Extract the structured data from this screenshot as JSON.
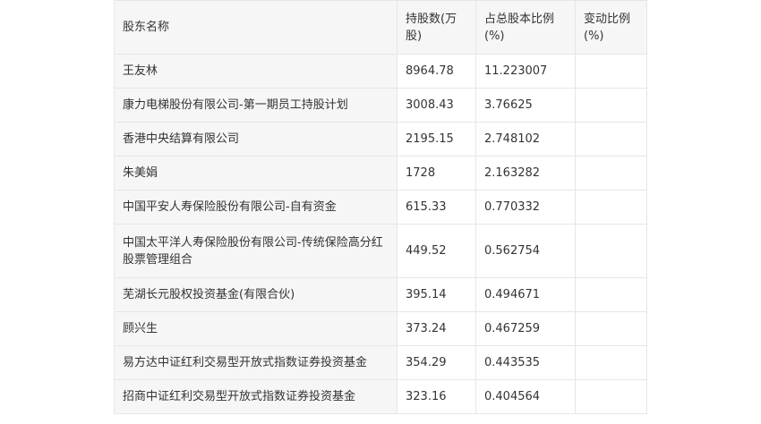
{
  "table": {
    "headers": {
      "name": "股东名称",
      "shares": "持股数(万股)",
      "ratio": "占总股本比例(%)",
      "change": "变动比例(%)"
    },
    "rows": [
      {
        "name": "王友林",
        "shares": "8964.78",
        "ratio": "11.223007",
        "change": ""
      },
      {
        "name": "康力电梯股份有限公司-第一期员工持股计划",
        "shares": "3008.43",
        "ratio": "3.76625",
        "change": ""
      },
      {
        "name": "香港中央结算有限公司",
        "shares": "2195.15",
        "ratio": "2.748102",
        "change": ""
      },
      {
        "name": "朱美娟",
        "shares": "1728",
        "ratio": "2.163282",
        "change": ""
      },
      {
        "name": "中国平安人寿保险股份有限公司-自有资金",
        "shares": "615.33",
        "ratio": "0.770332",
        "change": ""
      },
      {
        "name": "中国太平洋人寿保险股份有限公司-传统保险高分红股票管理组合",
        "shares": "449.52",
        "ratio": "0.562754",
        "change": ""
      },
      {
        "name": "芜湖长元股权投资基金(有限合伙)",
        "shares": "395.14",
        "ratio": "0.494671",
        "change": ""
      },
      {
        "name": "顾兴生",
        "shares": "373.24",
        "ratio": "0.467259",
        "change": ""
      },
      {
        "name": "易方达中证红利交易型开放式指数证券投资基金",
        "shares": "354.29",
        "ratio": "0.443535",
        "change": ""
      },
      {
        "name": "招商中证红利交易型开放式指数证券投资基金",
        "shares": "323.16",
        "ratio": "0.404564",
        "change": ""
      }
    ]
  }
}
